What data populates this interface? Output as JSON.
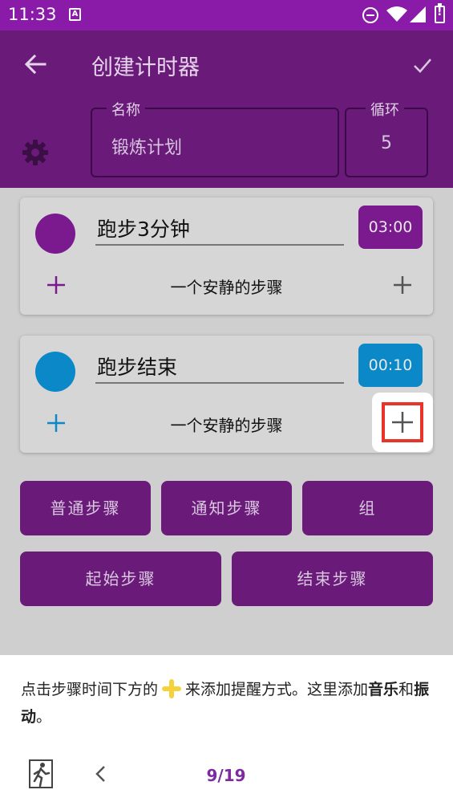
{
  "status_bar": {
    "time": "11:33",
    "a_badge": "A"
  },
  "toolbar": {
    "title": "创建计时器"
  },
  "timer": {
    "name_label": "名称",
    "name_value": "锻炼计划",
    "loop_label": "循环",
    "loop_value": "5"
  },
  "steps": [
    {
      "name": "跑步3分钟",
      "time": "03:00",
      "color": "#7b1a8f",
      "sub_label": "一个安静的步骤"
    },
    {
      "name": "跑步结束",
      "time": "00:10",
      "color": "#0a88c8",
      "sub_label": "一个安静的步骤"
    }
  ],
  "buttons": {
    "normal_step": "普通步骤",
    "notify_step": "通知步骤",
    "group": "组",
    "start_step": "起始步骤",
    "end_step": "结束步骤"
  },
  "tooltip": {
    "text_part1": "点击步骤时间下方的",
    "text_part2": "来添加提醒方式。这里添加",
    "bold_music": "音乐",
    "text_and": "和",
    "bold_vibration": "振动",
    "text_end": "。",
    "page": "9/19"
  },
  "colors": {
    "header": "#6a1b7a",
    "status_bar": "#8a1aa8",
    "accent_purple": "#7b1a8f",
    "accent_blue": "#0a88c8",
    "highlight_red": "#e8342a"
  }
}
